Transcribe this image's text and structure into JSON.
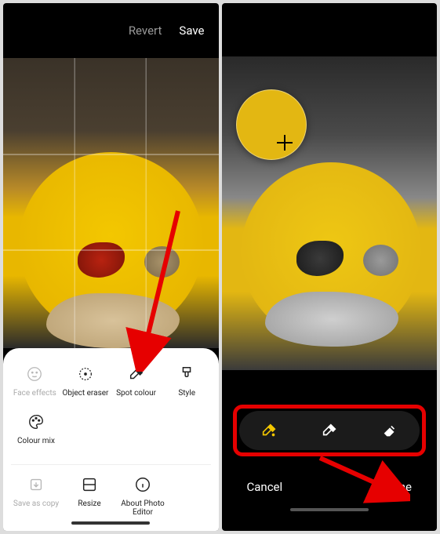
{
  "left": {
    "topbar": {
      "revert": "Revert",
      "save": "Save"
    },
    "tools_row1": [
      {
        "name": "face-effects",
        "label": "Face effects",
        "disabled": true
      },
      {
        "name": "object-eraser",
        "label": "Object eraser",
        "disabled": false
      },
      {
        "name": "spot-colour",
        "label": "Spot colour",
        "disabled": false
      },
      {
        "name": "style",
        "label": "Style",
        "disabled": false
      }
    ],
    "tools_row2": [
      {
        "name": "colour-mix",
        "label": "Colour mix",
        "disabled": false
      }
    ],
    "bottom_row": [
      {
        "name": "save-as-copy",
        "label": "Save as copy",
        "disabled": true
      },
      {
        "name": "resize",
        "label": "Resize",
        "disabled": false
      },
      {
        "name": "about",
        "label": "About Photo Editor",
        "disabled": false
      }
    ]
  },
  "right": {
    "brush_tools": [
      {
        "name": "eyedropper-active",
        "active": true
      },
      {
        "name": "eyedropper",
        "active": false
      },
      {
        "name": "eraser",
        "active": false
      }
    ],
    "footer": {
      "cancel": "Cancel",
      "done": "Done"
    }
  },
  "annotations": {
    "arrow_color": "#e60000"
  }
}
